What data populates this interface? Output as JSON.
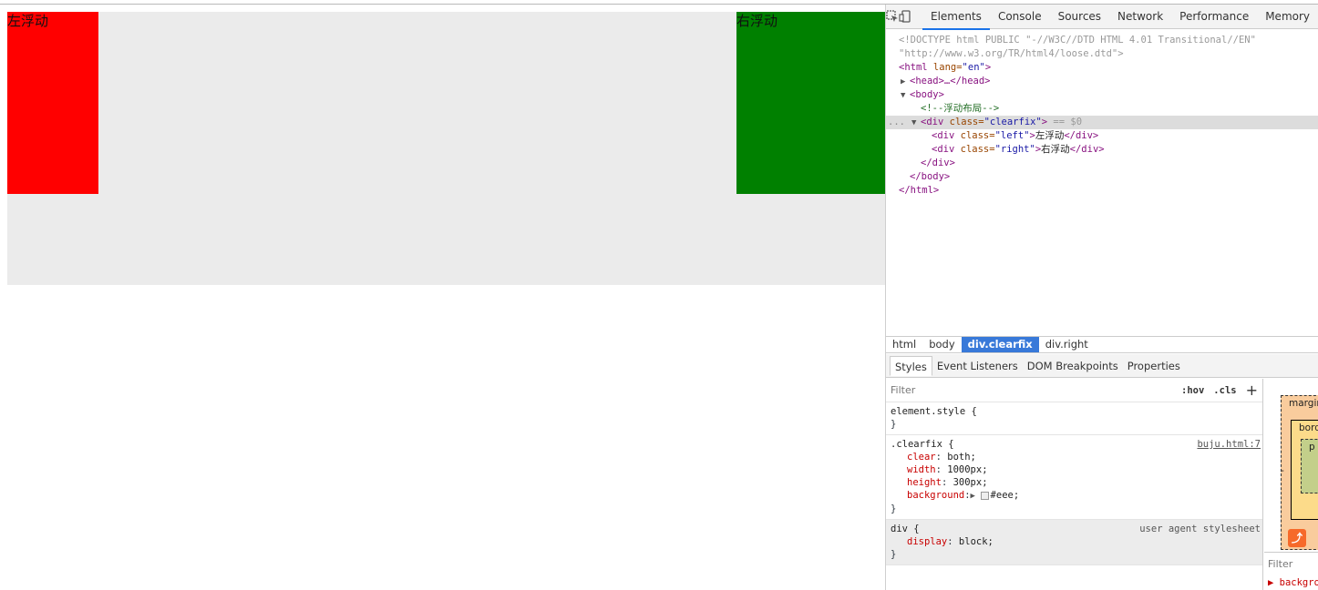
{
  "page": {
    "left_float_text": "左浮动",
    "right_float_text": "右浮动"
  },
  "devtools": {
    "tabs": [
      "Elements",
      "Console",
      "Sources",
      "Network",
      "Performance",
      "Memory"
    ],
    "dom": {
      "doctype_1": "<!DOCTYPE html PUBLIC \"-//W3C//DTD HTML 4.01 Transitional//EN\"",
      "doctype_2": "\"http://www.w3.org/TR/html4/loose.dtd\">",
      "html_open_tag": "<html",
      "html_attr": " lang=",
      "html_attr_val": "\"en\"",
      "html_close_bracket": ">",
      "head": "<head>…</head>",
      "body_open": "<body>",
      "comment": "<!--浮动布局-->",
      "div_open_tag": "<div",
      "div_attr": " class=",
      "div_attr_val": "\"clearfix\"",
      "div_bracket": ">",
      "div_sel_marker": " == $0",
      "left_tag_open": "<div",
      "left_attr": " class=",
      "left_attr_val": "\"left\"",
      "left_bracket": ">",
      "left_text": "左浮动",
      "left_close": "</div>",
      "right_tag_open": "<div",
      "right_attr": " class=",
      "right_attr_val": "\"right\"",
      "right_bracket": ">",
      "right_text": "右浮动",
      "right_close": "</div>",
      "div_close": "</div>",
      "body_close": "</body>",
      "html_close": "</html>",
      "ellipsis": "..."
    },
    "breadcrumbs": [
      "html",
      "body",
      "div.clearfix",
      "div.right"
    ],
    "subtabs": [
      "Styles",
      "Event Listeners",
      "DOM Breakpoints",
      "Properties"
    ],
    "styles": {
      "filter_placeholder": "Filter",
      "hov": ":hov",
      "cls": ".cls",
      "plus": "+",
      "element_style": "element.style {",
      "close_brace": "}",
      "clearfix_selector": ".clearfix {",
      "clearfix_source": "buju.html:7",
      "props": [
        {
          "name": "clear",
          "value": "both;"
        },
        {
          "name": "width",
          "value": "1000px;"
        },
        {
          "name": "height",
          "value": "300px;"
        }
      ],
      "bg_name": "background",
      "bg_value": "#eee;",
      "div_selector": "div {",
      "div_source": "user agent stylesheet",
      "div_prop_name": "display",
      "div_prop_value": "block;"
    },
    "boxmodel": {
      "margin_label": "margin",
      "border_label": "bord",
      "padding_label": "p",
      "dash": "-",
      "filter": "Filter",
      "bg_partial": "▶ backgro"
    }
  }
}
